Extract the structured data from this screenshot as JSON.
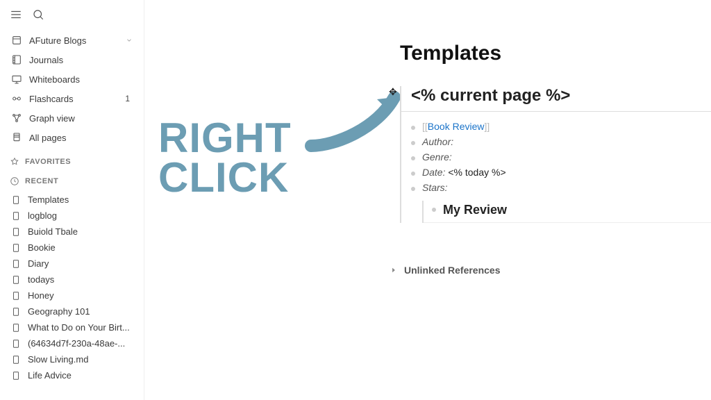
{
  "sidebar": {
    "workspace": {
      "label": "AFuture Blogs"
    },
    "nav": [
      {
        "label": "Journals",
        "icon": "journal"
      },
      {
        "label": "Whiteboards",
        "icon": "whiteboard"
      },
      {
        "label": "Flashcards",
        "icon": "flashcards",
        "badge": "1"
      },
      {
        "label": "Graph view",
        "icon": "graph"
      },
      {
        "label": "All pages",
        "icon": "pages"
      }
    ],
    "sections": {
      "favorites": "FAVORITES",
      "recent": "RECENT"
    },
    "recent": [
      "Templates",
      "logblog",
      "Buiold Tbale",
      "Bookie",
      "Diary",
      "todays",
      "Honey",
      "Geography 101",
      "What to Do on Your Birt...",
      "(64634d7f-230a-48ae-...",
      "Slow Living.md",
      "Life Advice"
    ]
  },
  "overlay": {
    "line1": "RIGHT",
    "line2": "CLICK"
  },
  "page": {
    "title": "Templates",
    "block_head": "<% current page %>",
    "link_label": "Book Review",
    "fields": {
      "author": "Author:",
      "genre": "Genre:",
      "date_label": "Date:",
      "date_value": "<% today %>",
      "stars": "Stars:"
    },
    "sub_title": "My Review",
    "refs": "Unlinked References"
  }
}
